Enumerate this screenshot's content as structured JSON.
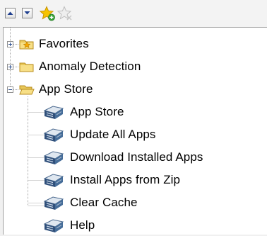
{
  "toolbar": {
    "collapse_icon": "chevron-up-icon",
    "expand_icon": "chevron-down-icon",
    "add_favorite_icon": "star-add-icon",
    "remove_favorite_icon": "star-disabled-icon"
  },
  "tree": {
    "favorites": {
      "label": "Favorites",
      "icon": "favorites-folder-icon"
    },
    "anomaly": {
      "label": "Anomaly Detection",
      "icon": "folder-icon"
    },
    "app_store": {
      "label": "App Store",
      "icon": "open-folder-icon",
      "children": [
        {
          "label": "App Store",
          "icon": "app-icon"
        },
        {
          "label": "Update All Apps",
          "icon": "app-icon"
        },
        {
          "label": "Download Installed Apps",
          "icon": "app-icon"
        },
        {
          "label": "Install Apps from Zip",
          "icon": "app-icon"
        },
        {
          "label": "Clear Cache",
          "icon": "app-icon"
        },
        {
          "label": "Help",
          "icon": "app-icon"
        }
      ]
    }
  },
  "colors": {
    "folder": "#f2d46b",
    "app_icon_dark": "#2f4f7a",
    "app_icon_light": "#9fb4cc",
    "star": "#f5c400",
    "plus_badge": "#3aa43a"
  }
}
